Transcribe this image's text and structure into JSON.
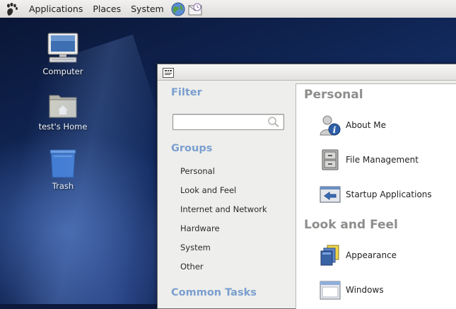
{
  "panel": {
    "menus": [
      "Applications",
      "Places",
      "System"
    ],
    "icons": [
      "gnome-foot-icon",
      "web-browser-icon",
      "mail-client-icon"
    ]
  },
  "desktop": {
    "icons": [
      {
        "label": "Computer",
        "icon": "computer-icon"
      },
      {
        "label": "test's Home",
        "icon": "home-folder-icon"
      },
      {
        "label": "Trash",
        "icon": "trash-icon"
      }
    ]
  },
  "window": {
    "titlebar_button": "",
    "sidebar": {
      "filter_title": "Filter",
      "filter_value": "",
      "filter_placeholder": "",
      "groups_title": "Groups",
      "groups": [
        "Personal",
        "Look and Feel",
        "Internet and Network",
        "Hardware",
        "System",
        "Other"
      ],
      "common_tasks_title": "Common Tasks"
    },
    "main": {
      "categories": [
        {
          "title": "Personal",
          "items": [
            {
              "label": "About Me",
              "icon": "about-me-icon"
            },
            {
              "label": "File Management",
              "icon": "file-cabinet-icon"
            },
            {
              "label": "Startup Applications",
              "icon": "startup-applications-icon"
            }
          ]
        },
        {
          "title": "Look and Feel",
          "items": [
            {
              "label": "Appearance",
              "icon": "appearance-icon"
            },
            {
              "label": "Windows",
              "icon": "windows-icon"
            }
          ]
        }
      ]
    }
  },
  "colors": {
    "section_title": "#7a9fcf",
    "category_title": "#8d8d8b",
    "desktop_bg": "#0d1a3d"
  }
}
